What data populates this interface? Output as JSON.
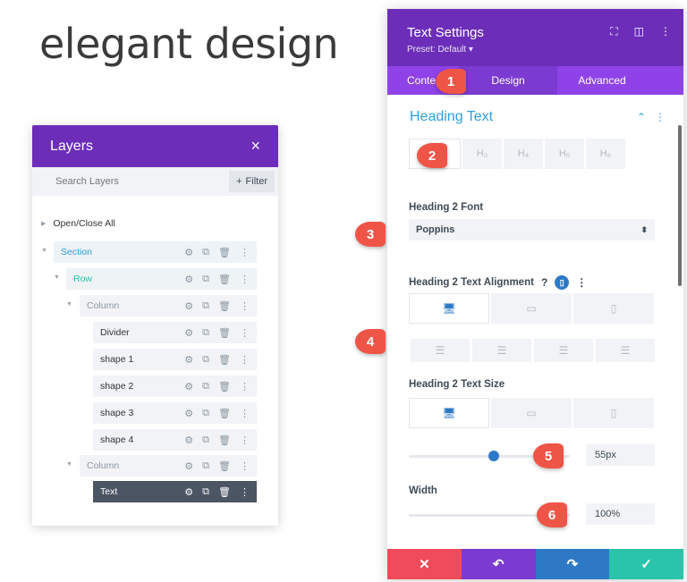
{
  "headline": "elegant design",
  "layers": {
    "title": "Layers",
    "close_icon": "×",
    "search_placeholder": "Search Layers",
    "filter_label": "Filter",
    "open_close_all": "Open/Close All",
    "items": [
      {
        "label": "Section",
        "kind": "section"
      },
      {
        "label": "Row",
        "kind": "row"
      },
      {
        "label": "Column",
        "kind": "column"
      },
      {
        "label": "Divider",
        "kind": "module"
      },
      {
        "label": "shape 1",
        "kind": "module"
      },
      {
        "label": "shape 2",
        "kind": "module"
      },
      {
        "label": "shape 3",
        "kind": "module"
      },
      {
        "label": "shape 4",
        "kind": "module"
      },
      {
        "label": "Column",
        "kind": "column"
      },
      {
        "label": "Text",
        "kind": "module",
        "selected": true
      }
    ]
  },
  "settings": {
    "title": "Text Settings",
    "preset": "Preset: Default ▾",
    "tabs": [
      "Content",
      "Design",
      "Advanced"
    ],
    "active_tab": "Design",
    "section_title": "Heading Text",
    "heading_levels": [
      "H₂",
      "H₃",
      "H₄",
      "H₅",
      "H₆"
    ],
    "active_heading": "H₂",
    "font_label": "Heading 2 Font",
    "font_value": "Poppins",
    "alignment_label": "Heading 2 Text Alignment",
    "size_label": "Heading 2 Text Size",
    "size_value": "55px",
    "size_slider": 0.53,
    "width_label": "Width",
    "width_value": "100%",
    "width_slider": 1.0,
    "colors": {
      "purple_header": "#6c2eb9",
      "tab_bar": "#8f42e8",
      "cancel": "#ef4b5a",
      "undo": "#7b3ad0",
      "redo": "#2e79c6",
      "save": "#29c4a9",
      "marker": "#ef5547"
    }
  },
  "markers": [
    "1",
    "2",
    "3",
    "4",
    "5",
    "6"
  ]
}
